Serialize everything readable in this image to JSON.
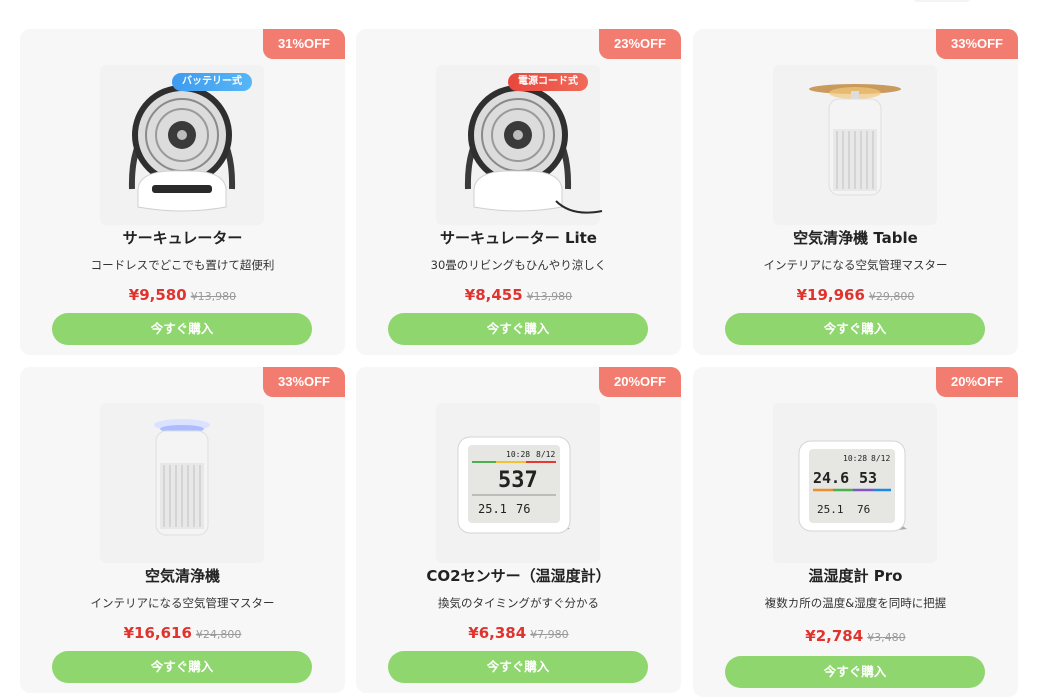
{
  "products": [
    {
      "discount": "31%OFF",
      "tag": "バッテリー式",
      "tag_color": "#3e9bf0",
      "title": "サーキュレーター",
      "desc": "コードレスでどこでも置けて超便利",
      "price": "¥9,580",
      "orig": "¥13,980",
      "button": "今すぐ購入",
      "icon": "circulator-fan-icon"
    },
    {
      "discount": "23%OFF",
      "tag": "電源コード式",
      "tag_color": "#e8473c",
      "title": "サーキュレーター Lite",
      "desc": "30畳のリビングもひんやり涼しく",
      "price": "¥8,455",
      "orig": "¥13,980",
      "button": "今すぐ購入",
      "icon": "circulator-fan-corded-icon"
    },
    {
      "discount": "33%OFF",
      "title": "空気清浄機 Table",
      "desc": "インテリアになる空気管理マスター",
      "price": "¥19,966",
      "orig": "¥29,800",
      "button": "今すぐ購入",
      "icon": "air-purifier-table-icon"
    },
    {
      "discount": "33%OFF",
      "title": "空気清浄機",
      "desc": "インテリアになる空気管理マスター",
      "price": "¥16,616",
      "orig": "¥24,800",
      "button": "今すぐ購入",
      "icon": "air-purifier-icon"
    },
    {
      "discount": "20%OFF",
      "title": "CO2センサー（温湿度計）",
      "desc": "換気のタイミングがすぐ分かる",
      "price": "¥6,384",
      "orig": "¥7,980",
      "button": "今すぐ購入",
      "icon": "co2-sensor-icon",
      "display": {
        "time": "10:28",
        "date": "8/12",
        "main": "537",
        "temp": "25.1",
        "hum": "76"
      }
    },
    {
      "discount": "20%OFF",
      "title": "温湿度計 Pro",
      "desc": "複数カ所の温度&湿度を同時に把握",
      "price": "¥2,784",
      "orig": "¥3,480",
      "button": "今すぐ購入",
      "icon": "thermo-hygrometer-icon",
      "display": {
        "time": "10:28",
        "date": "8/12",
        "main_temp": "24.6",
        "main_hum": "53",
        "temp": "25.1",
        "hum": "76"
      }
    }
  ]
}
